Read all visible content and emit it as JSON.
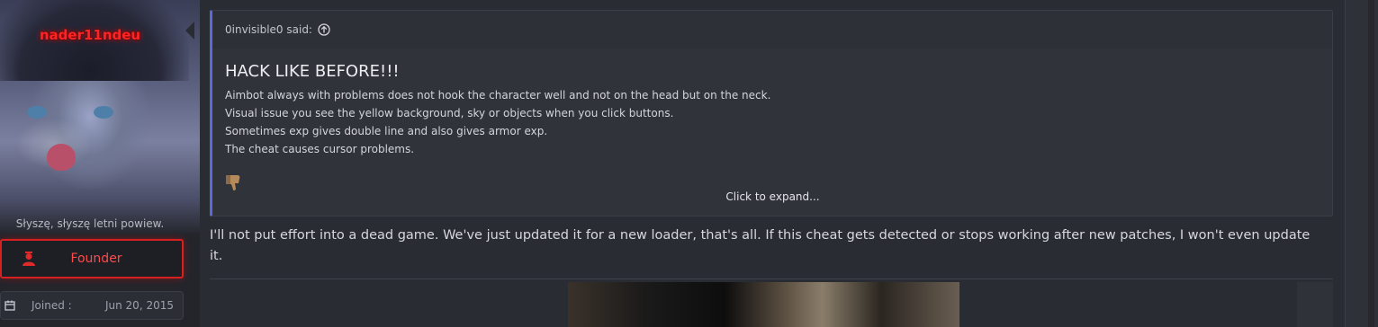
{
  "user": {
    "username": "nader11ndeu",
    "tagline": "Słyszę, słyszę letni powiew.",
    "rank_label": "Founder",
    "rank_icon": "user-icon",
    "joined_label": "Joined :",
    "joined_value": "Jun 20, 2015",
    "name_color": "#ff2424"
  },
  "quote": {
    "author_said": "0invisible0 said:",
    "title": "HACK LIKE BEFORE!!!",
    "lines": [
      "Aimbot always with problems does not hook the character well and not on the head but on the neck.",
      "Visual issue you see the yellow background, sky or objects when you click buttons.",
      "Sometimes exp gives double line and also gives armor exp.",
      "The cheat causes cursor problems."
    ],
    "expand_label": "Click to expand...",
    "accent_color": "#5b6ad6"
  },
  "post": {
    "body": "I'll not put effort into a dead game. We've just updated it for a new loader, that's all. If this cheat gets detected or stops working after new patches, I won't even update it."
  }
}
